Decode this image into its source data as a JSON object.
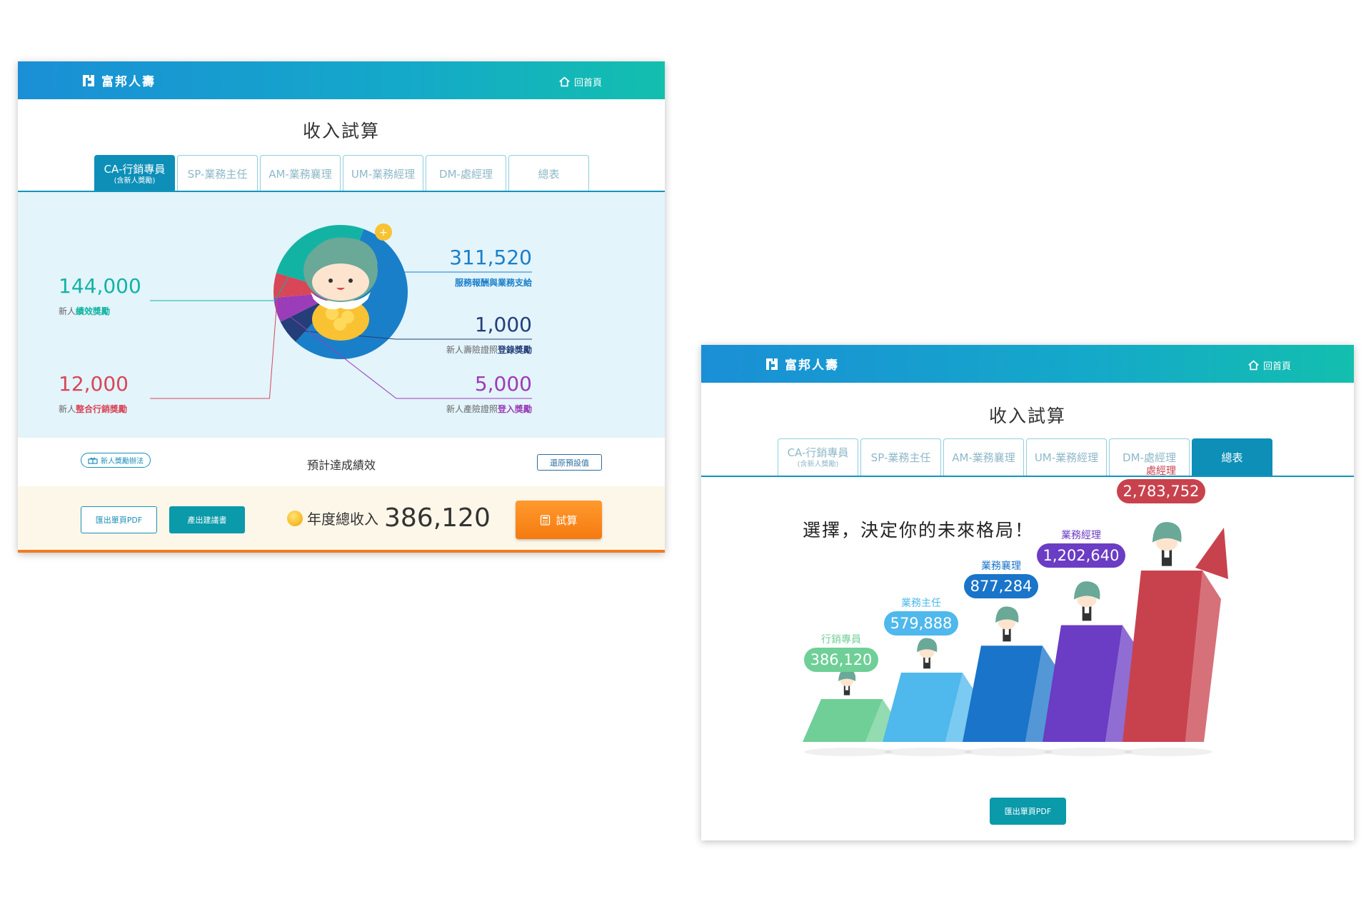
{
  "brand": {
    "name": "富邦人壽",
    "home_label": "回首頁"
  },
  "screen_a": {
    "title": "收入試算",
    "tabs": [
      {
        "label": "CA-行銷專員",
        "sub": "(含新人獎勵)"
      },
      {
        "label": "SP-業務主任"
      },
      {
        "label": "AM-業務襄理"
      },
      {
        "label": "UM-業務經理"
      },
      {
        "label": "DM-處經理"
      },
      {
        "label": "總表"
      }
    ],
    "chart_data": {
      "type": "pie",
      "categories": [
        "服務報酬與業務支給",
        "新人壽險證照登錄獎勵",
        "新人產險證照登入獎勵",
        "新人整合行銷獎勵",
        "新人績效獎勵"
      ],
      "values": [
        311520,
        1000,
        5000,
        12000,
        144000
      ],
      "value_labels": [
        "311,520",
        "1,000",
        "5,000",
        "12,000",
        "144,000"
      ],
      "label_parts": [
        {
          "plain": "",
          "bold": "服務報酬與業務支給"
        },
        {
          "plain": "新人壽險證照",
          "bold": "登錄獎勵"
        },
        {
          "plain": "新人產險證照",
          "bold": "登入獎勵"
        },
        {
          "plain": "新人",
          "bold": "整合行銷獎勵"
        },
        {
          "plain": "新人",
          "bold": "績效獎勵"
        }
      ],
      "colors": [
        "#1a7fc9",
        "#233e78",
        "#9b3cb8",
        "#d84658",
        "#13b3a4"
      ]
    },
    "rule_pill": "新人獎勵辦法",
    "perf_title": "預計達成績效",
    "reset_label": "還原預設值",
    "export_pdf": "匯出單頁PDF",
    "proposal": "產出建議書",
    "annual_label": "年度總收入",
    "annual_value": "386,120",
    "calc_label": "試算"
  },
  "screen_b": {
    "title": "收入試算",
    "tabs": [
      {
        "label": "CA-行銷專員",
        "sub": "(含新人獎勵)"
      },
      {
        "label": "SP-業務主任"
      },
      {
        "label": "AM-業務襄理"
      },
      {
        "label": "UM-業務經理"
      },
      {
        "label": "DM-處經理"
      },
      {
        "label": "總表"
      }
    ],
    "slogan": "選擇，決定你的未來格局！",
    "chart_data": {
      "type": "bar",
      "categories": [
        "行銷專員",
        "業務主任",
        "業務襄理",
        "業務經理",
        "處經理"
      ],
      "values": [
        386120,
        579888,
        877284,
        1202640,
        2783752
      ],
      "value_labels": [
        "386,120",
        "579,888",
        "877,284",
        "1,202,640",
        "2,783,752"
      ],
      "colors": [
        "#6fcf97",
        "#4fb8ec",
        "#1a74c9",
        "#6b3cc4",
        "#c8424d"
      ]
    },
    "export_pdf": "匯出單頁PDF"
  }
}
